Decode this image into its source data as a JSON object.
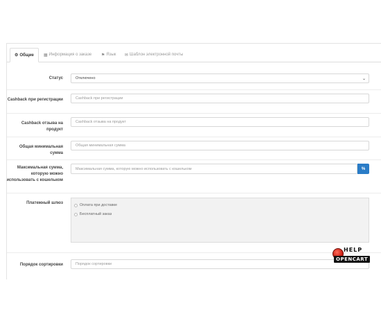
{
  "tabs": [
    {
      "icon": "⚙",
      "label": "Общие",
      "active": true
    },
    {
      "icon": "▦",
      "label": "Информация о заказе",
      "active": false
    },
    {
      "icon": "⚑",
      "label": "Язык",
      "active": false
    },
    {
      "icon": "✉",
      "label": "Шаблон электронной почты",
      "active": false
    }
  ],
  "form": {
    "status": {
      "label": "Статус",
      "value": "Отключено"
    },
    "cashback_registration": {
      "label": "Cashback при регистрации",
      "placeholder": "Cashback при регистрации"
    },
    "cashback_review": {
      "label": "Cashback отзыва на продукт",
      "placeholder": "Cashback отзыва на продукт"
    },
    "min_total": {
      "label": "Общая минимальная сумма",
      "placeholder": "Общая минимальная сумма"
    },
    "max_wallet": {
      "label": "Максимальная сумма, которую можно использовать с кошельком",
      "placeholder": "Максимальная сумма, которую можно использовать с кошельком",
      "addon": "%"
    },
    "payment_gateway": {
      "label": "Платежный шлюз",
      "options": [
        "Оплата при доставке",
        "Бесплатный заказ"
      ]
    },
    "sort_order": {
      "label": "Порядок сортировки",
      "placeholder": "Порядок сортировки"
    }
  },
  "logo": {
    "line1": "HELP",
    "line2": "OPENCART"
  },
  "colors": {
    "accent": "#2a7cc7",
    "logo_red": "#c0150a"
  }
}
